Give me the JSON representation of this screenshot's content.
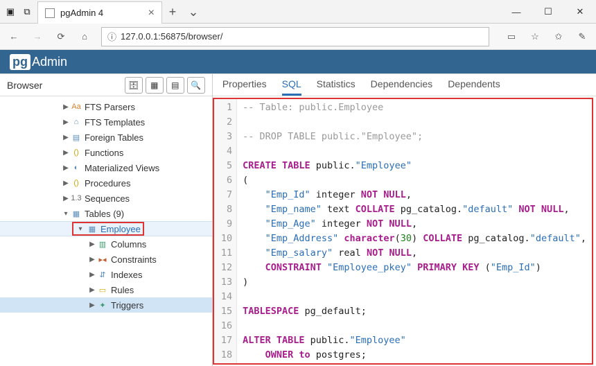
{
  "window": {
    "tab_title": "pgAdmin 4",
    "url": "127.0.0.1:56875/browser/"
  },
  "pgadmin": {
    "logo_text": "Admin",
    "logo_pg": "pg"
  },
  "browser": {
    "title": "Browser",
    "tree": [
      {
        "pad": 88,
        "arrow": "▶",
        "ic": "Aa",
        "ic_color": "#d9822b",
        "label": "FTS Parsers"
      },
      {
        "pad": 88,
        "arrow": "▶",
        "ic": "⌂",
        "ic_color": "#5b8db8",
        "label": "FTS Templates"
      },
      {
        "pad": 88,
        "arrow": "▶",
        "ic": "▤",
        "ic_color": "#5b8db8",
        "label": "Foreign Tables"
      },
      {
        "pad": 88,
        "arrow": "▶",
        "ic": "()",
        "ic_color": "#c9a400",
        "label": "Functions"
      },
      {
        "pad": 88,
        "arrow": "▶",
        "ic": "◐",
        "ic_color": "#5b8db8",
        "label": "Materialized Views"
      },
      {
        "pad": 88,
        "arrow": "▶",
        "ic": "()",
        "ic_color": "#c9a400",
        "label": "Procedures"
      },
      {
        "pad": 88,
        "arrow": "▶",
        "ic": "1.3",
        "ic_color": "#6b6b6b",
        "label": "Sequences"
      },
      {
        "pad": 88,
        "arrow": "▾",
        "ic": "▦",
        "ic_color": "#5b8db8",
        "label": "Tables (9)"
      },
      {
        "pad": 104,
        "arrow": "",
        "ic": "",
        "label": "",
        "selected": true,
        "sel_arrow": "▾",
        "sel_ic": "▦",
        "sel_label": "Employee"
      },
      {
        "pad": 126,
        "arrow": "▶",
        "ic": "▥",
        "ic_color": "#3b9b6d",
        "label": "Columns"
      },
      {
        "pad": 126,
        "arrow": "▶",
        "ic": "▸◂",
        "ic_color": "#c05b2a",
        "label": "Constraints"
      },
      {
        "pad": 126,
        "arrow": "▶",
        "ic": "⇵",
        "ic_color": "#5b8db8",
        "label": "Indexes"
      },
      {
        "pad": 126,
        "arrow": "▶",
        "ic": "▭",
        "ic_color": "#c9a400",
        "label": "Rules"
      },
      {
        "pad": 126,
        "arrow": "▶",
        "ic": "✦",
        "ic_color": "#3b9b6d",
        "label": "Triggers",
        "row_hl": true
      }
    ]
  },
  "content_tabs": {
    "items": [
      "Properties",
      "SQL",
      "Statistics",
      "Dependencies",
      "Dependents"
    ],
    "active": "SQL"
  },
  "sql": {
    "lines": [
      [
        {
          "t": "-- Table: public.Employee",
          "c": "c-com"
        }
      ],
      [],
      [
        {
          "t": "-- DROP TABLE public.\"Employee\";",
          "c": "c-com"
        }
      ],
      [],
      [
        {
          "t": "CREATE TABLE",
          "c": "c-kw"
        },
        {
          "t": " public."
        },
        {
          "t": "\"Employee\"",
          "c": "c-str"
        }
      ],
      [
        {
          "t": "("
        }
      ],
      [
        {
          "t": "    "
        },
        {
          "t": "\"Emp_Id\"",
          "c": "c-str"
        },
        {
          "t": " integer "
        },
        {
          "t": "NOT NULL",
          "c": "c-kw"
        },
        {
          "t": ","
        }
      ],
      [
        {
          "t": "    "
        },
        {
          "t": "\"Emp_name\"",
          "c": "c-str"
        },
        {
          "t": " text "
        },
        {
          "t": "COLLATE",
          "c": "c-kw"
        },
        {
          "t": " pg_catalog."
        },
        {
          "t": "\"default\"",
          "c": "c-str"
        },
        {
          "t": " "
        },
        {
          "t": "NOT NULL",
          "c": "c-kw"
        },
        {
          "t": ","
        }
      ],
      [
        {
          "t": "    "
        },
        {
          "t": "\"Emp_Age\"",
          "c": "c-str"
        },
        {
          "t": " integer "
        },
        {
          "t": "NOT NULL",
          "c": "c-kw"
        },
        {
          "t": ","
        }
      ],
      [
        {
          "t": "    "
        },
        {
          "t": "\"Emp_Address\"",
          "c": "c-str"
        },
        {
          "t": " "
        },
        {
          "t": "character",
          "c": "c-kw"
        },
        {
          "t": "("
        },
        {
          "t": "30",
          "c": "c-num"
        },
        {
          "t": ") "
        },
        {
          "t": "COLLATE",
          "c": "c-kw"
        },
        {
          "t": " pg_catalog."
        },
        {
          "t": "\"default\"",
          "c": "c-str"
        },
        {
          "t": ","
        }
      ],
      [
        {
          "t": "    "
        },
        {
          "t": "\"Emp_salary\"",
          "c": "c-str"
        },
        {
          "t": " real "
        },
        {
          "t": "NOT NULL",
          "c": "c-kw"
        },
        {
          "t": ","
        }
      ],
      [
        {
          "t": "    "
        },
        {
          "t": "CONSTRAINT",
          "c": "c-kw"
        },
        {
          "t": " "
        },
        {
          "t": "\"Employee_pkey\"",
          "c": "c-str"
        },
        {
          "t": " "
        },
        {
          "t": "PRIMARY KEY",
          "c": "c-kw"
        },
        {
          "t": " ("
        },
        {
          "t": "\"Emp_Id\"",
          "c": "c-str"
        },
        {
          "t": ")"
        }
      ],
      [
        {
          "t": ")"
        }
      ],
      [],
      [
        {
          "t": "TABLESPACE",
          "c": "c-kw"
        },
        {
          "t": " pg_default;"
        }
      ],
      [],
      [
        {
          "t": "ALTER TABLE",
          "c": "c-kw"
        },
        {
          "t": " public."
        },
        {
          "t": "\"Employee\"",
          "c": "c-str"
        }
      ],
      [
        {
          "t": "    "
        },
        {
          "t": "OWNER to",
          "c": "c-kw"
        },
        {
          "t": " postgres;"
        }
      ]
    ]
  }
}
